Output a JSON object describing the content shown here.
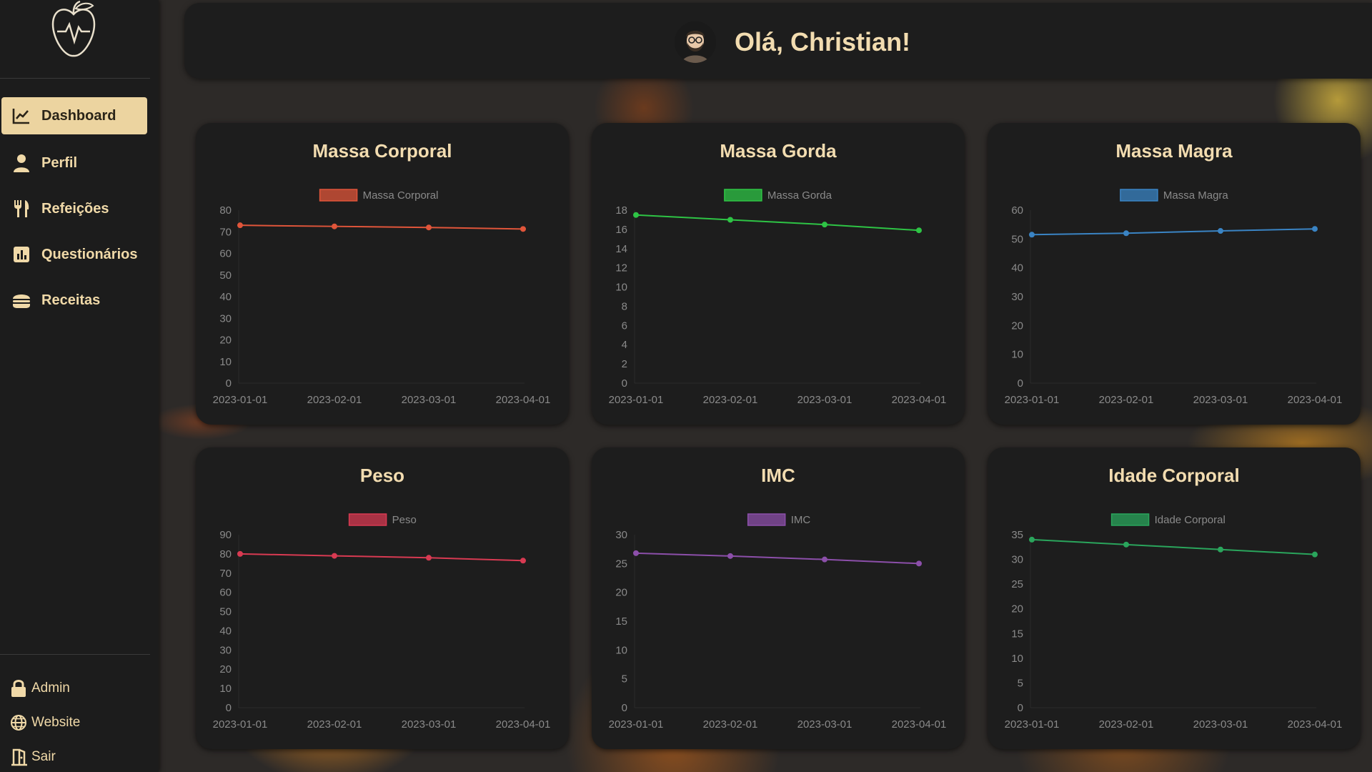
{
  "sidebar": {
    "items": [
      {
        "label": "Dashboard",
        "icon": "chart-line-icon",
        "active": true
      },
      {
        "label": "Perfil",
        "icon": "user-icon",
        "active": false
      },
      {
        "label": "Refeições",
        "icon": "utensils-icon",
        "active": false
      },
      {
        "label": "Questionários",
        "icon": "bar-chart-icon",
        "active": false
      },
      {
        "label": "Receitas",
        "icon": "burger-icon",
        "active": false
      }
    ],
    "footer": [
      {
        "label": "Admin",
        "icon": "lock-icon"
      },
      {
        "label": "Website",
        "icon": "globe-icon"
      },
      {
        "label": "Sair",
        "icon": "exit-icon"
      }
    ]
  },
  "header": {
    "greeting": "Olá, Christian!"
  },
  "colors": {
    "accent": "#ecd4a0",
    "text": "#f2dcb0",
    "massa_corporal": "#e0553a",
    "massa_gorda": "#2ec445",
    "massa_magra": "#3a84c4",
    "peso": "#d83a52",
    "imc": "#8c4faa",
    "idade_corporal": "#2aa55c"
  },
  "chart_data": [
    {
      "type": "line",
      "title": "Massa Corporal",
      "legend": "Massa Corporal",
      "color": "#e0553a",
      "x": [
        "2023-01-01",
        "2023-02-01",
        "2023-03-01",
        "2023-04-01"
      ],
      "values": [
        73,
        72.5,
        72,
        71.3
      ],
      "ylim": [
        0,
        80
      ],
      "yticks": [
        0,
        10,
        20,
        30,
        40,
        50,
        60,
        70,
        80
      ]
    },
    {
      "type": "line",
      "title": "Massa Gorda",
      "legend": "Massa Gorda",
      "color": "#2ec445",
      "x": [
        "2023-01-01",
        "2023-02-01",
        "2023-03-01",
        "2023-04-01"
      ],
      "values": [
        17.5,
        17,
        16.5,
        15.9
      ],
      "ylim": [
        0,
        18
      ],
      "yticks": [
        0,
        2,
        4,
        6,
        8,
        10,
        12,
        14,
        16,
        18
      ]
    },
    {
      "type": "line",
      "title": "Massa Magra",
      "legend": "Massa Magra",
      "color": "#3a84c4",
      "x": [
        "2023-01-01",
        "2023-02-01",
        "2023-03-01",
        "2023-04-01"
      ],
      "values": [
        51.5,
        52,
        52.8,
        53.5
      ],
      "ylim": [
        0,
        60
      ],
      "yticks": [
        0,
        10,
        20,
        30,
        40,
        50,
        60
      ]
    },
    {
      "type": "line",
      "title": "Peso",
      "legend": "Peso",
      "color": "#d83a52",
      "x": [
        "2023-01-01",
        "2023-02-01",
        "2023-03-01",
        "2023-04-01"
      ],
      "values": [
        80,
        79,
        78,
        76.5
      ],
      "ylim": [
        0,
        90
      ],
      "yticks": [
        0,
        10,
        20,
        30,
        40,
        50,
        60,
        70,
        80,
        90
      ]
    },
    {
      "type": "line",
      "title": "IMC",
      "legend": "IMC",
      "color": "#8c4faa",
      "x": [
        "2023-01-01",
        "2023-02-01",
        "2023-03-01",
        "2023-04-01"
      ],
      "values": [
        26.8,
        26.3,
        25.7,
        25
      ],
      "ylim": [
        0,
        30
      ],
      "yticks": [
        0,
        5,
        10,
        15,
        20,
        25,
        30
      ]
    },
    {
      "type": "line",
      "title": "Idade Corporal",
      "legend": "Idade Corporal",
      "color": "#2aa55c",
      "x": [
        "2023-01-01",
        "2023-02-01",
        "2023-03-01",
        "2023-04-01"
      ],
      "values": [
        34,
        33,
        32,
        31
      ],
      "ylim": [
        0,
        35
      ],
      "yticks": [
        0,
        5,
        10,
        15,
        20,
        25,
        30,
        35
      ]
    }
  ]
}
